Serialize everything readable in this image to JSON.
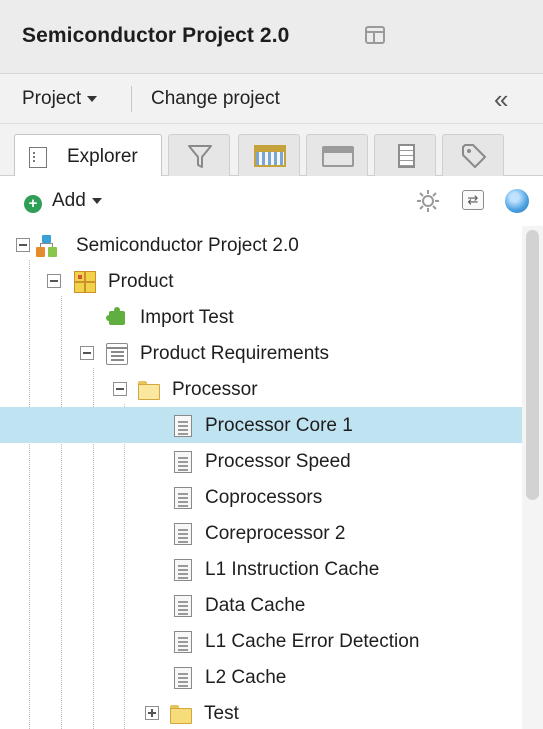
{
  "header": {
    "title": "Semiconductor Project 2.0"
  },
  "project_bar": {
    "project_menu": "Project",
    "change_project": "Change project",
    "collapse_glyph": "«"
  },
  "tabs": [
    {
      "label": "Explorer",
      "icon": "document-icon",
      "active": true
    },
    {
      "label": "",
      "icon": "filter-icon"
    },
    {
      "label": "",
      "icon": "grid-view-icon"
    },
    {
      "label": "",
      "icon": "window-icon"
    },
    {
      "label": "",
      "icon": "notes-icon"
    },
    {
      "label": "",
      "icon": "tag-icon"
    }
  ],
  "toolbar": {
    "add_label": "Add",
    "gear_icon": "gear-icon",
    "swap_icon": "swap-icon",
    "swap_glyph": "⇄",
    "globe_icon": "globe-icon"
  },
  "tree": [
    {
      "label": "Semiconductor Project 2.0",
      "icon": "project-icon",
      "expanded": true
    },
    {
      "label": "Product",
      "icon": "product-icon",
      "expanded": true
    },
    {
      "label": "Import Test",
      "icon": "puzzle-icon"
    },
    {
      "label": "Product Requirements",
      "icon": "requirements-icon",
      "expanded": true
    },
    {
      "label": "Processor",
      "icon": "folder-open-icon",
      "expanded": true
    },
    {
      "label": "Processor Core 1",
      "icon": "document-icon",
      "selected": true
    },
    {
      "label": "Processor Speed",
      "icon": "document-icon"
    },
    {
      "label": "Coprocessors",
      "icon": "document-icon"
    },
    {
      "label": "Coreprocessor 2",
      "icon": "document-icon"
    },
    {
      "label": "L1 Instruction Cache",
      "icon": "document-icon"
    },
    {
      "label": "Data Cache",
      "icon": "document-icon"
    },
    {
      "label": "L1 Cache Error Detection",
      "icon": "document-icon"
    },
    {
      "label": "L2 Cache",
      "icon": "document-icon"
    },
    {
      "label": "Test",
      "icon": "folder-icon",
      "expanded": false
    }
  ],
  "colors": {
    "selection": "#bfe3f0",
    "header_bg": "#ececec",
    "add_green": "#2f9e57"
  }
}
